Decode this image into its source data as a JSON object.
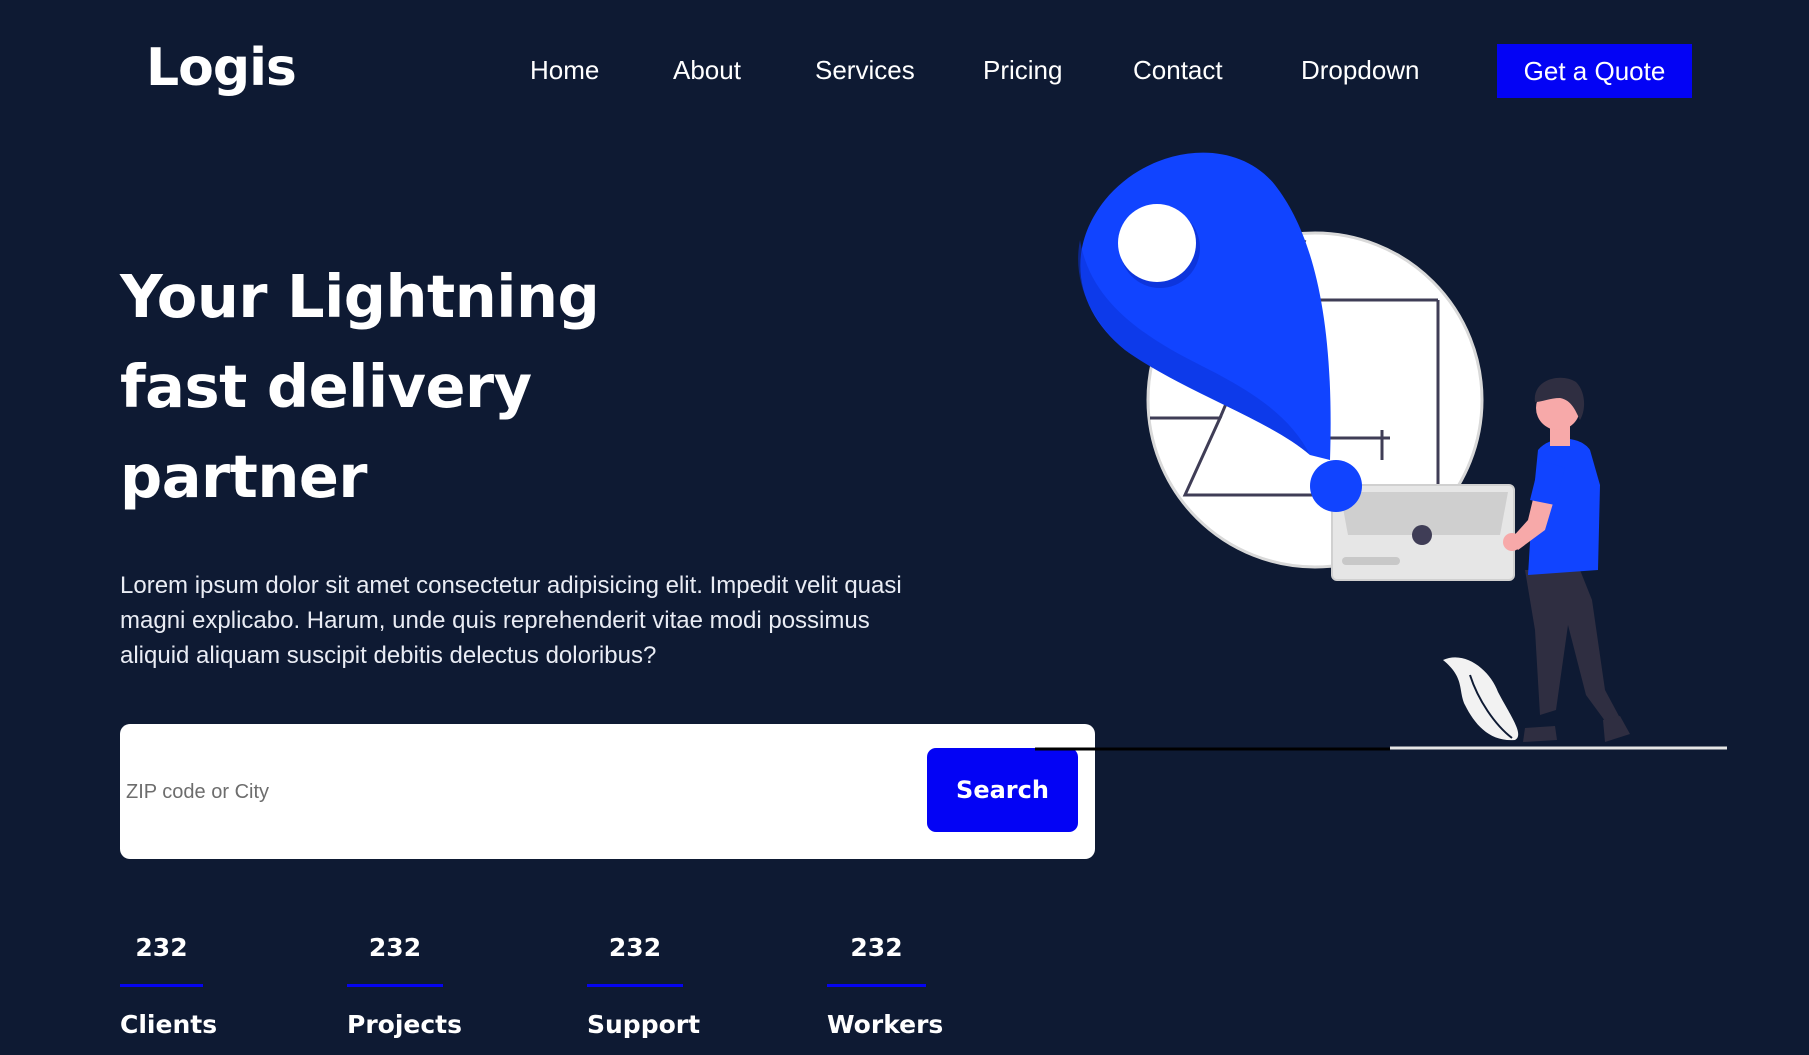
{
  "brand": {
    "logo": "Logis"
  },
  "nav": {
    "items": [
      {
        "label": "Home"
      },
      {
        "label": "About"
      },
      {
        "label": "Services"
      },
      {
        "label": "Pricing"
      },
      {
        "label": "Contact"
      },
      {
        "label": "Dropdown"
      }
    ],
    "cta_label": "Get a Quote"
  },
  "hero": {
    "title_lines": [
      "Your Lightning",
      "fast delivery",
      "partner"
    ],
    "description": "Lorem ipsum dolor sit amet consectetur adipisicing elit. Impedit velit quasi magni explicabo. Harum, unde quis reprehenderit vitae modi possimus aliquid aliquam suscipit debitis delectus doloribus?"
  },
  "search": {
    "placeholder": "ZIP code or City",
    "value": "",
    "button_label": "Search"
  },
  "stats": [
    {
      "value": "232",
      "label": "Clients"
    },
    {
      "value": "232",
      "label": "Projects"
    },
    {
      "value": "232",
      "label": "Support"
    },
    {
      "value": "232",
      "label": "Workers"
    }
  ],
  "colors": {
    "background": "#0e1a33",
    "accent": "#0303f5",
    "illustration_blue": "#1144ff",
    "text": "#ffffff"
  },
  "illustration": {
    "name": "delivery-person-with-map-pin-illustration"
  }
}
